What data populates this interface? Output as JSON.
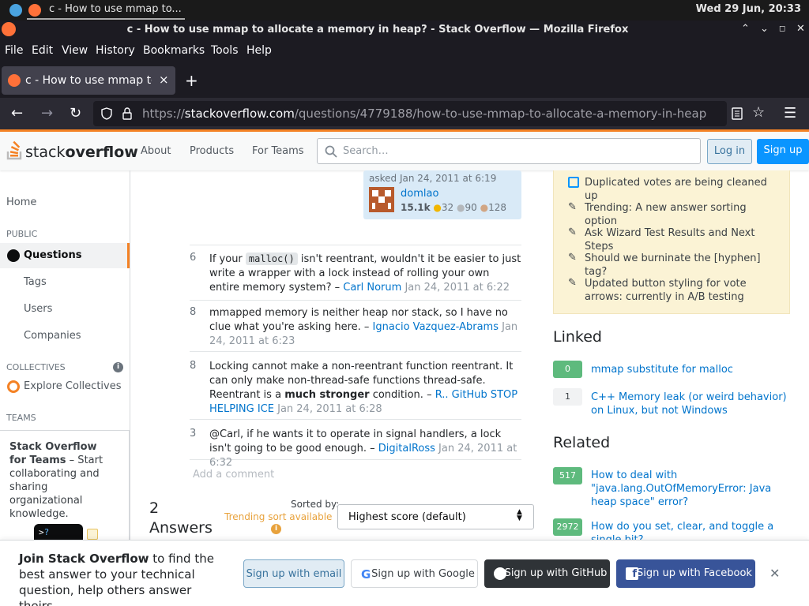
{
  "system": {
    "tab_title": "c - How to use mmap to...",
    "clock": "Wed 29 Jun, 20:33"
  },
  "window": {
    "title": "c - How to use mmap to allocate a memory in heap? - Stack Overflow — Mozilla Firefox",
    "minimize": "⌃",
    "maximize": "⌄",
    "restore": "◻",
    "close": "✕"
  },
  "menu": [
    "File",
    "Edit",
    "View",
    "History",
    "Bookmarks",
    "Tools",
    "Help"
  ],
  "tab": {
    "label": "c - How to use mmap to",
    "close": "×",
    "new": "+"
  },
  "nav": {
    "back": "←",
    "forward": "→",
    "reload": "↻",
    "url_prefix": "https://",
    "url_domain": "stackoverflow.com",
    "url_path": "/questions/4779188/how-to-use-mmap-to-allocate-a-memory-in-heap",
    "menu": "☰"
  },
  "so_header": {
    "logo_a": "stack",
    "logo_b": "overflow",
    "about": "About",
    "products": "Products",
    "teams": "For Teams",
    "search_placeholder": "Search…",
    "login": "Log in",
    "signup": "Sign up"
  },
  "left_nav": {
    "home": "Home",
    "public": "PUBLIC",
    "questions": "Questions",
    "tags": "Tags",
    "users": "Users",
    "companies": "Companies",
    "collectives": "COLLECTIVES",
    "explore": "Explore Collectives",
    "teams": "TEAMS",
    "teams_title": "Stack Overflow for Teams",
    "teams_text": " – Start collaborating and sharing organizational knowledge."
  },
  "asker": {
    "asked": "asked Jan 24, 2011 at 6:19",
    "name": "domlao",
    "rep": "15.1k",
    "gold": "32",
    "silver": "90",
    "bronze": "128"
  },
  "comments": [
    {
      "score": "6",
      "pre": "If your ",
      "code": "malloc()",
      "post": " isn't reentrant, wouldn't it be easier to just write a wrapper with a lock instead of rolling your own entire memory system? – ",
      "user": "Carl Norum",
      "time": "Jan 24, 2011 at 6:22"
    },
    {
      "score": "8",
      "text": "mmapped memory is neither heap nor stack, so I have no clue what you're asking here. – ",
      "user": "Ignacio Vazquez-Abrams",
      "time": "Jan 24, 2011 at 6:23"
    },
    {
      "score": "8",
      "pre": "Locking cannot make a non-reentrant function reentrant. It can only make non-thread-safe functions thread-safe. Reentrant is a ",
      "bold": "much stronger",
      "post": " condition. – ",
      "user": "R.. GitHub STOP HELPING ICE",
      "time": "Jan 24, 2011 at 6:28"
    },
    {
      "score": "3",
      "text": "@Carl, if he wants it to operate in signal handlers, a lock isn't going to be good enough. – ",
      "user": "DigitalRoss",
      "time": "Jan 24, 2011 at 6:32"
    }
  ],
  "add_comment": "Add a comment",
  "answers": {
    "count": "2",
    "label": "Answers",
    "sorted_by": "Sorted by:",
    "trending": "Trending sort available",
    "sort_value": "Highest score (default)"
  },
  "blog": [
    "Duplicated votes are being cleaned up",
    "Trending: A new answer sorting option",
    "Ask Wizard Test Results and Next Steps",
    "Should we burninate the [hyphen] tag?",
    "Updated button styling for vote arrows: currently in A/B testing"
  ],
  "linked": {
    "heading": "Linked",
    "items": [
      {
        "score": "0",
        "title": "mmap substitute for malloc"
      },
      {
        "score": "1",
        "title": "C++ Memory leak (or weird behavior) on Linux, but not Windows"
      }
    ]
  },
  "related": {
    "heading": "Related",
    "items": [
      {
        "score": "517",
        "title": "How to deal with \"java.lang.OutOfMemoryError: Java heap space\" error?"
      },
      {
        "score": "2972",
        "title": "How do you set, clear, and toggle a single bit?"
      }
    ]
  },
  "banner": {
    "bold": "Join Stack Overflow",
    "text": " to find the best answer to your technical question, help others answer theirs.",
    "email": "Sign up with email",
    "google": "Sign up with Google",
    "github": "Sign up with GitHub",
    "facebook": "Sign up with Facebook",
    "close": "✕"
  },
  "colors": {
    "accent": "#f48225",
    "link": "#0074cc",
    "primary": "#0a95ff",
    "accepted_green": "#5eba7d"
  }
}
